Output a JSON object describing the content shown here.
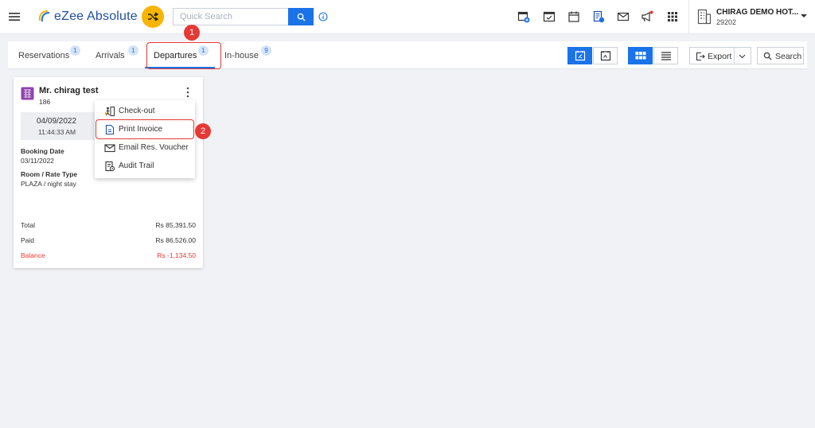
{
  "app": {
    "name": "eZee Absolute",
    "accent": "#1a73e8",
    "brand_yellow": "#f7b500"
  },
  "search": {
    "placeholder": "Quick Search"
  },
  "header": {
    "icons": [
      "calendar-plus-icon",
      "calendar-check-icon",
      "calendar-icon",
      "report-icon",
      "mail-icon",
      "announcement-icon",
      "apps-grid-icon"
    ],
    "hotel_name": "CHIRAG DEMO HOT...",
    "hotel_id": "29202"
  },
  "tabs": [
    {
      "label": "Reservations",
      "count": "1"
    },
    {
      "label": "Arrivals",
      "count": "1"
    },
    {
      "label": "Departures",
      "count": "1",
      "active": true
    },
    {
      "label": "In-house",
      "count": "9"
    }
  ],
  "toolbar": {
    "export_label": "Export",
    "search_label": "Search"
  },
  "annotations": {
    "step1": "1",
    "step2": "2",
    "color": "#e53935"
  },
  "card": {
    "guest_name": "Mr. chirag test",
    "room_no": "186",
    "departure_date": "04/09/2022",
    "departure_time": "11:44:33 AM",
    "booking_date_label": "Booking Date",
    "booking_date": "03/11/2022",
    "room_rate_label": "Room / Rate Type",
    "room_rate": "PLAZA / night stay",
    "total_label": "Total",
    "total": "Rs 85,391.50",
    "paid_label": "Paid",
    "paid": "Rs 86,526.00",
    "balance_label": "Balance",
    "balance": "Rs -1,134.50",
    "balance_color": "#e53935"
  },
  "context_menu": {
    "items": [
      {
        "label": "Check-out",
        "icon": "checkout-icon"
      },
      {
        "label": "Print Invoice",
        "icon": "invoice-icon"
      },
      {
        "label": "Email Res. Voucher",
        "icon": "mail-icon"
      },
      {
        "label": "Audit Trail",
        "icon": "audit-icon"
      }
    ]
  }
}
